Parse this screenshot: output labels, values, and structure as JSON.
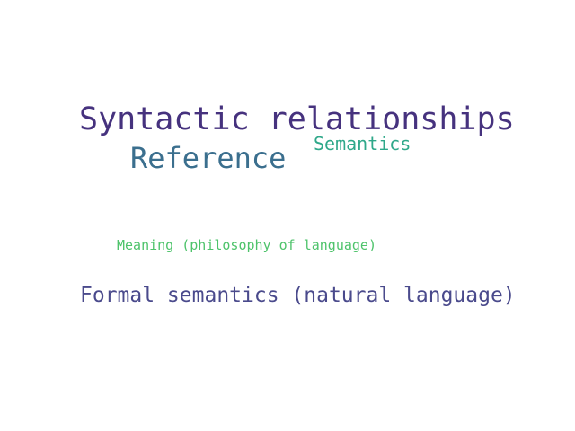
{
  "word_cloud": {
    "words": [
      {
        "text": "Syntactic relationships",
        "color": "#46327e"
      },
      {
        "text": "Reference",
        "color": "#3b6f8e"
      },
      {
        "text": "Semantics",
        "color": "#2fa88a"
      },
      {
        "text": "Meaning (philosophy of language)",
        "color": "#4ec36b"
      },
      {
        "text": "Formal semantics (natural language)",
        "color": "#4a4a8c"
      }
    ]
  }
}
